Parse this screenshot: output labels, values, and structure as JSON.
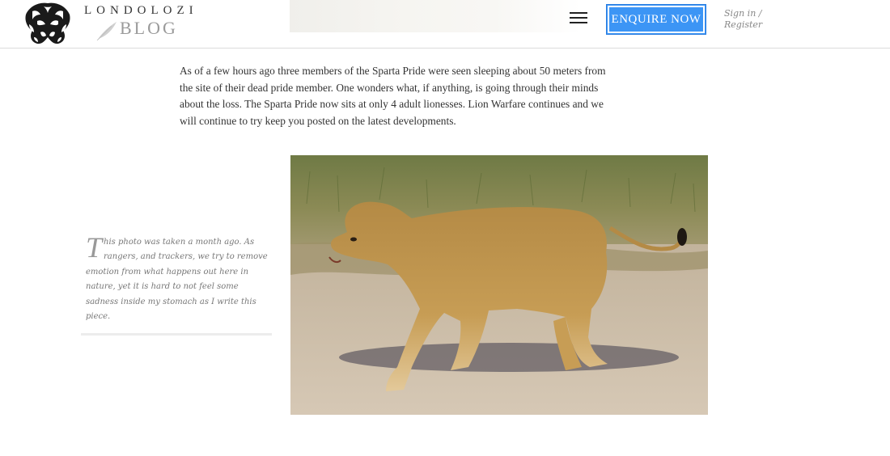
{
  "header": {
    "brand_top": "LONDOLOZI",
    "brand_bottom": "BLOG",
    "menu_icon": "hamburger-menu-icon",
    "enquire_label": "ENQUIRE NOW",
    "signin_line1": "Sign in /",
    "signin_line2": "Register",
    "accent_color": "#3c95f5"
  },
  "article": {
    "paragraph": "As of a few hours ago three members of the Sparta Pride were seen sleeping about 50 meters from the site of their dead pride member. One wonders what, if anything, is going through their minds about the loss. The Sparta Pride now sits at only 4 adult lionesses. Lion Warfare continues and we will continue to try keep you posted on the latest developments."
  },
  "caption": {
    "dropcap": "T",
    "text": "his photo was taken a month ago. As rangers, and trackers, we try to remove emotion from what happens out here in nature, yet it is hard to not feel some sadness inside my stomach as I write this piece."
  },
  "photo": {
    "subject": "lioness walking on sandy road"
  }
}
